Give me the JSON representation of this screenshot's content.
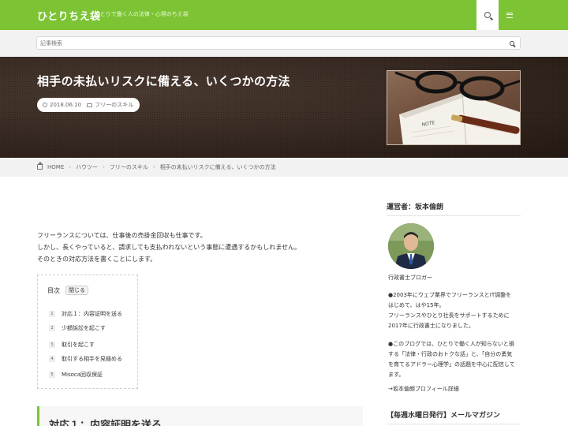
{
  "header": {
    "site_title": "ひとりちえ袋",
    "tagline": "ひとりで働く人の法律・心得のちえ袋",
    "accent_color": "#7cc433",
    "icons": {
      "search": "search-icon",
      "menu": "hamburger-menu-icon"
    }
  },
  "search": {
    "placeholder": "記事検索"
  },
  "post": {
    "title": "相手の未払いリスクに備える、いくつかの方法",
    "date": "2018.06.10",
    "category": "フリーのスキル"
  },
  "breadcrumb": {
    "items": [
      "HOME",
      "ハウツー",
      "フリーのスキル",
      "相手の未払いリスクに備える、いくつかの方法"
    ]
  },
  "intro": {
    "lines": [
      "フリーランスについては、仕事後の売掛金回収も仕事です。",
      "しかし、長くやっていると、請求しても支払われないという事態に遭遇するかもしれません。",
      "そのときの対応方法を書くことにします。"
    ]
  },
  "toc": {
    "title": "目次",
    "toggle_label": "閉じる",
    "items": [
      {
        "num": "1",
        "label": "対応１：内容証明を送る"
      },
      {
        "num": "2",
        "label": "少額訴訟を起こす"
      },
      {
        "num": "3",
        "label": "取引を起こす"
      },
      {
        "num": "4",
        "label": "取引する相手を見極める"
      },
      {
        "num": "5",
        "label": "Misoca回収保証"
      }
    ]
  },
  "section": {
    "heading": "対応１：内容証明を送る"
  },
  "sidebar": {
    "operator_heading": "運営者：坂本倫朗",
    "role": "行政書士ブロガー",
    "bio1": [
      "●2003年にウェブ業界でフリーランスとIT調整を",
      "はじめて、はや15年。",
      "フリーランスやひとり社長をサポートするために",
      "2017年に行政書士になりました。"
    ],
    "bio2": [
      "●このブログでは、ひとりで働く人が知らないと損",
      "する「法律・行政のおトクな話」と、「自分の勇気",
      "を育てるアドラー心理学」の話題を中心に配信して",
      "ます。"
    ],
    "profile_link": "→坂本倫朗プロフィール詳細",
    "newsletter_heading": "【毎週水曜日発行】メールマガジン"
  }
}
